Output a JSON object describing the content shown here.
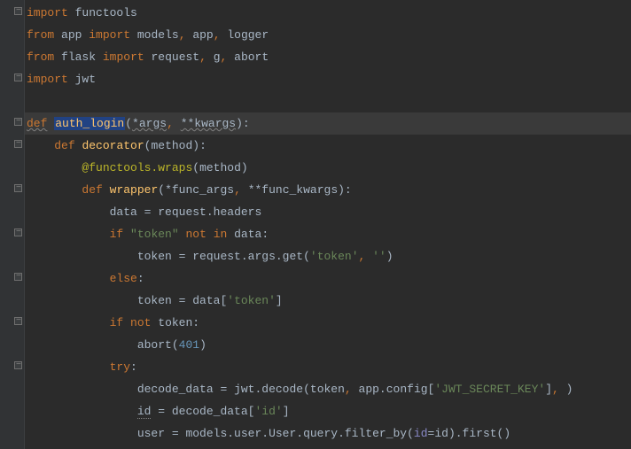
{
  "code": {
    "l1": {
      "import": "import",
      "module": "functools"
    },
    "l2": {
      "from": "from",
      "pkg": "app",
      "import": "import",
      "m1": "models",
      "m2": "app",
      "m3": "logger"
    },
    "l3": {
      "from": "from",
      "pkg": "flask",
      "import": "import",
      "m1": "request",
      "m2": "g",
      "m3": "abort"
    },
    "l4": {
      "import": "import",
      "module": "jwt"
    },
    "l6": {
      "def": "def",
      "name": "auth_login",
      "args": "*args",
      "kwargs": "**kwargs"
    },
    "l7": {
      "def": "def",
      "name": "decorator",
      "arg": "method"
    },
    "l8": {
      "dec": "@functools.wraps",
      "arg": "method"
    },
    "l9": {
      "def": "def",
      "name": "wrapper",
      "a1": "*func_args",
      "a2": "**func_kwargs"
    },
    "l10": {
      "var": "data",
      "val": "request.headers"
    },
    "l11": {
      "if": "if",
      "str": "\"token\"",
      "not": "not",
      "in": "in",
      "v": "data"
    },
    "l12": {
      "var": "token",
      "call": "request.args.get",
      "s1": "'token'",
      "s2": "''"
    },
    "l13": {
      "else": "else"
    },
    "l14": {
      "var": "token",
      "d": "data",
      "key": "'token'"
    },
    "l15": {
      "if": "if",
      "not": "not",
      "v": "token"
    },
    "l16": {
      "fn": "abort",
      "n": "401"
    },
    "l17": {
      "try": "try"
    },
    "l18": {
      "var": "decode_data",
      "mod": "jwt.decode",
      "a1": "token",
      "a2": "app.config",
      "key": "'JWT_SECRET_KEY'"
    },
    "l19": {
      "var": "id",
      "src": "decode_data",
      "key": "'id'"
    },
    "l20": {
      "var": "user",
      "q": "models.user.User.query.filter_by",
      "k": "id",
      "v": "id",
      "first": ".first()"
    }
  }
}
